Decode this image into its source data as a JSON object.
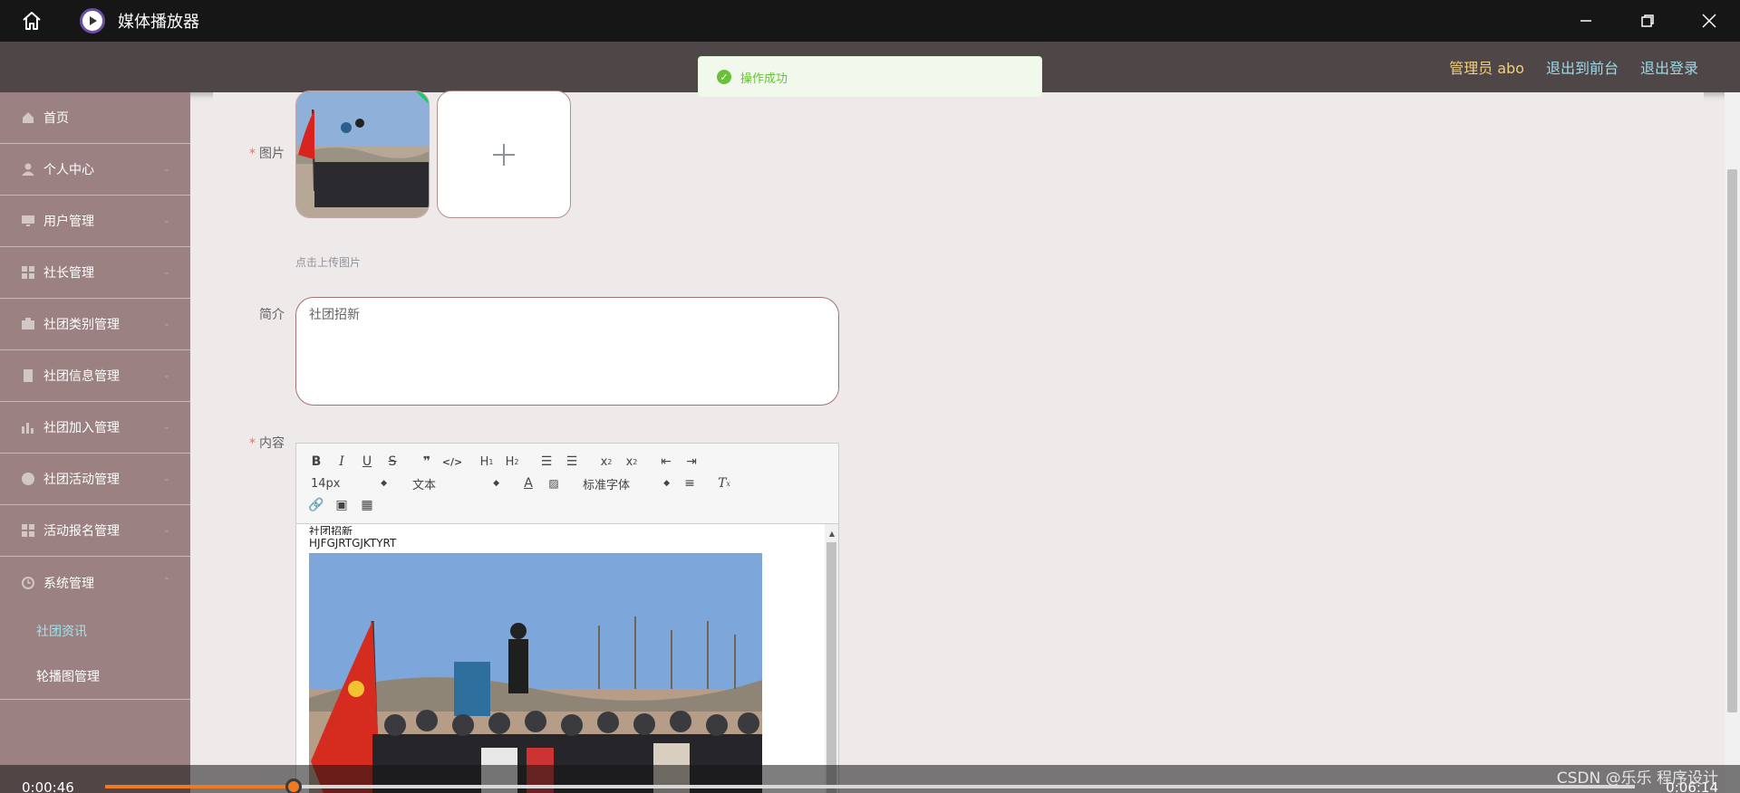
{
  "window": {
    "title": "媒体播放器"
  },
  "header": {
    "user": "管理员 abo",
    "to_front": "退出到前台",
    "logout": "退出登录"
  },
  "toast": {
    "text": "操作成功"
  },
  "sidebar": {
    "items": [
      {
        "label": "首页",
        "icon": "home-icon"
      },
      {
        "label": "个人中心",
        "icon": "user-icon"
      },
      {
        "label": "用户管理",
        "icon": "monitor-icon"
      },
      {
        "label": "社长管理",
        "icon": "grid-icon"
      },
      {
        "label": "社团类别管理",
        "icon": "briefcase-icon"
      },
      {
        "label": "社团信息管理",
        "icon": "document-icon"
      },
      {
        "label": "社团加入管理",
        "icon": "chart-icon"
      },
      {
        "label": "社团活动管理",
        "icon": "globe-icon"
      },
      {
        "label": "活动报名管理",
        "icon": "grid-icon"
      },
      {
        "label": "系统管理",
        "icon": "clock-icon"
      }
    ],
    "submenu": [
      {
        "label": "社团资讯",
        "active": true
      },
      {
        "label": "轮播图管理",
        "active": false
      }
    ]
  },
  "form": {
    "picture_label": "图片",
    "upload_hint": "点击上传图片",
    "intro_label": "简介",
    "intro_value": "社团招新",
    "content_label": "内容"
  },
  "editor": {
    "font_size": "14px",
    "heading": "文本",
    "font_family": "标准字体",
    "body_line1": "社团招新",
    "body_line2": "HJFGJRTGJKTYRT"
  },
  "player": {
    "elapsed": "0:00:46",
    "total": "0:06:14",
    "progress": 0.123,
    "watermark": "CSDN @乐乐 程序设计"
  },
  "colors": {
    "accent": "#f07a1e",
    "sidebar": "#9b8181",
    "header": "#4f4747",
    "success": "#67c23a"
  }
}
